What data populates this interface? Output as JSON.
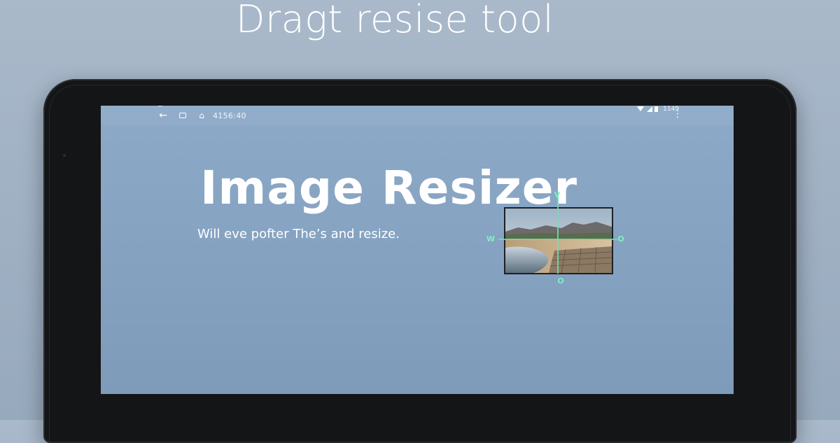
{
  "header": {
    "title": "Dragt resise tool"
  },
  "status_bar": {
    "time": "4156:40",
    "right_text": "1149",
    "icons": [
      "back-arrow-icon",
      "recent-apps-icon",
      "home-icon",
      "wifi-icon",
      "signal-icon",
      "battery-icon",
      "more-vert-icon"
    ]
  },
  "app": {
    "title": "Image Resizer",
    "subtitle": "Will eve pofter The’s and resize."
  },
  "resize_tool": {
    "handles": {
      "top": "V",
      "left": "W",
      "right": "O",
      "bottom": "O"
    }
  },
  "colors": {
    "guide": "#6fe0b0",
    "screen": "#8da9c8",
    "background": "#a9b9ca"
  }
}
